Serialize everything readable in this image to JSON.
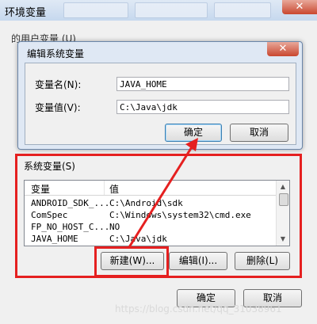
{
  "background_window": {
    "title": "环境变量",
    "close_glyph": "✕",
    "user_group_label": "的用户变量 (U)",
    "system_group_label": "系统变量(S)",
    "columns": [
      "变量",
      "值"
    ],
    "rows": [
      {
        "name": "ANDROID_SDK_...",
        "value": "C:\\Android\\sdk"
      },
      {
        "name": "ComSpec",
        "value": "C:\\Windows\\system32\\cmd.exe"
      },
      {
        "name": "FP_NO_HOST_C...",
        "value": "NO"
      },
      {
        "name": "JAVA_HOME",
        "value": "C:\\Java\\jdk"
      }
    ],
    "buttons": {
      "new": "新建(W)...",
      "edit": "编辑(I)...",
      "delete": "删除(L)"
    },
    "ok": "确定",
    "cancel": "取消"
  },
  "dialog": {
    "title": "编辑系统变量",
    "close_glyph": "✕",
    "name_label": "变量名(N):",
    "name_value": "JAVA_HOME",
    "value_label": "变量值(V):",
    "value_value": "C:\\Java\\jdk",
    "ok": "确定",
    "cancel": "取消"
  },
  "watermark": "https://blog.csdn.net/qq_31038961",
  "colors": {
    "highlight": "#e52020",
    "accent": "#3c7fb1"
  }
}
